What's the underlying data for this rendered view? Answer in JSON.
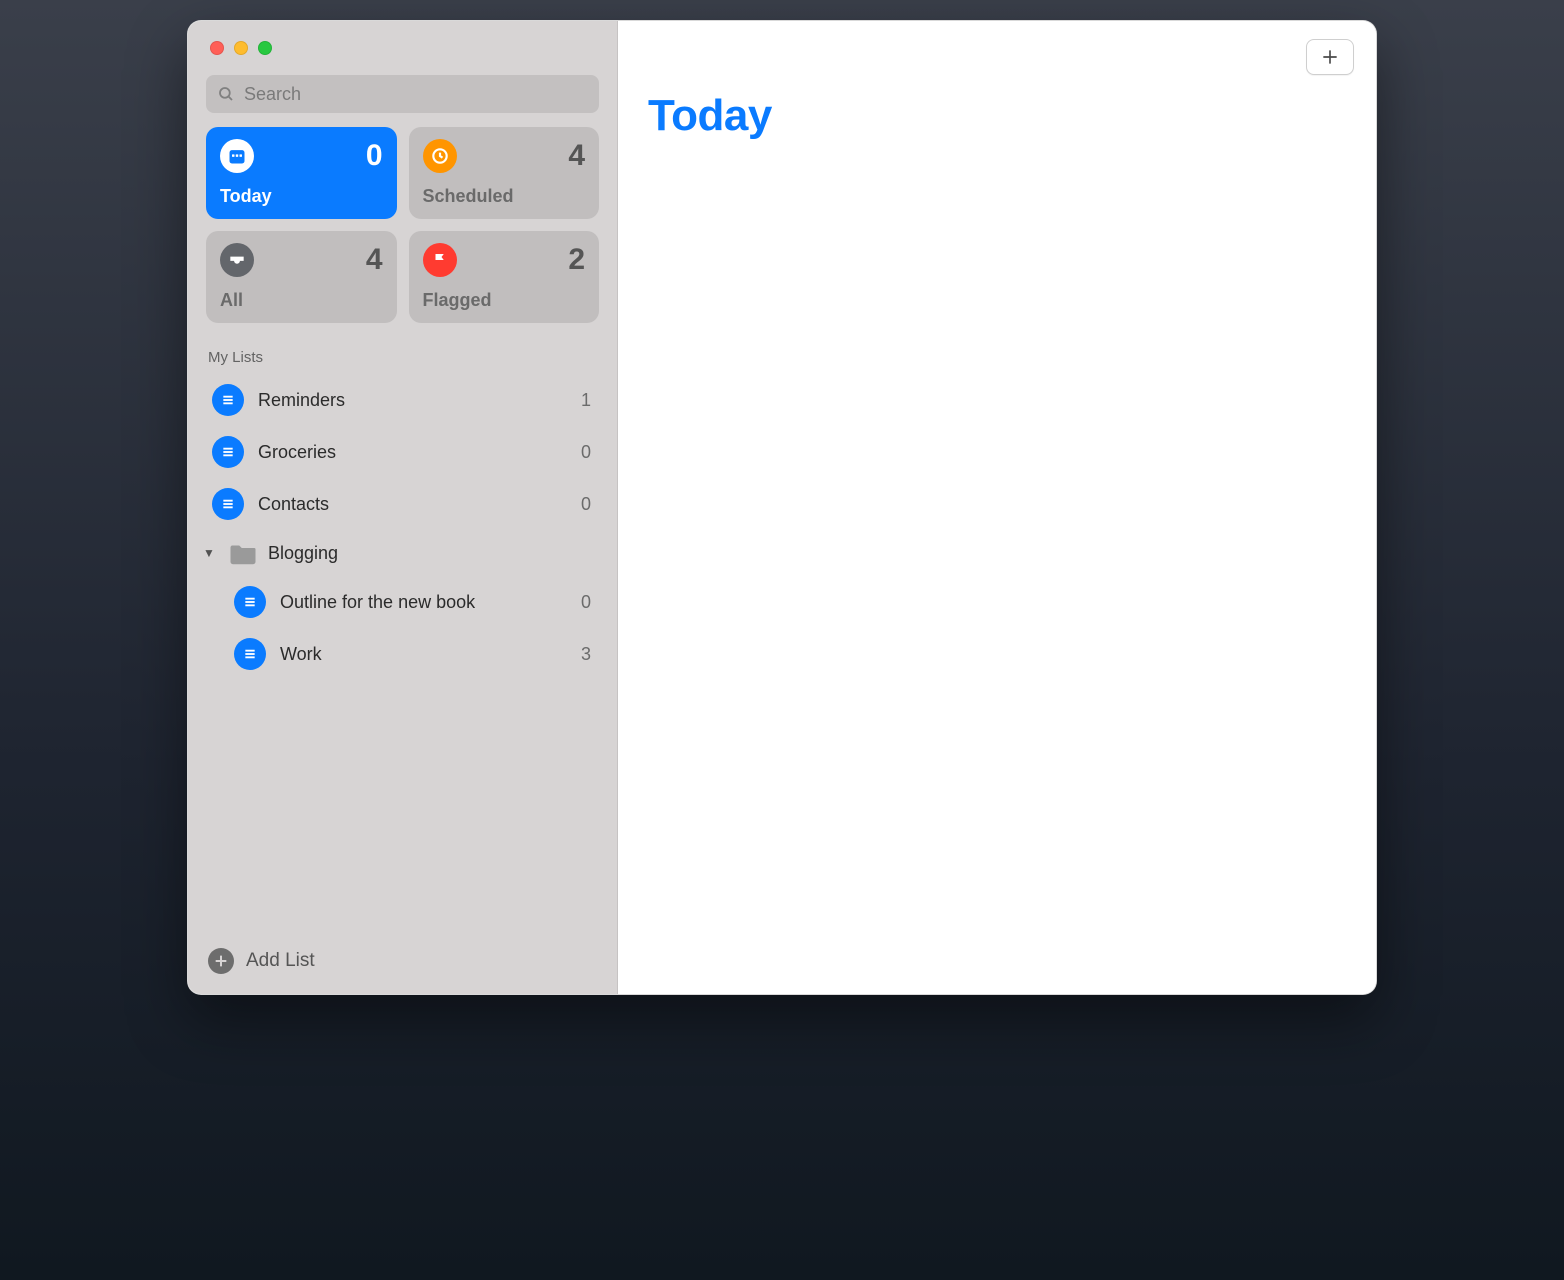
{
  "search": {
    "placeholder": "Search"
  },
  "smart": {
    "today": {
      "label": "Today",
      "count": "0"
    },
    "scheduled": {
      "label": "Scheduled",
      "count": "4"
    },
    "all": {
      "label": "All",
      "count": "4"
    },
    "flagged": {
      "label": "Flagged",
      "count": "2"
    }
  },
  "sections": {
    "my_lists": "My Lists"
  },
  "lists": {
    "reminders": {
      "label": "Reminders",
      "count": "1"
    },
    "groceries": {
      "label": "Groceries",
      "count": "0"
    },
    "contacts": {
      "label": "Contacts",
      "count": "0"
    },
    "blogging": {
      "label": "Blogging"
    },
    "outline": {
      "label": "Outline for the new book",
      "count": "0"
    },
    "work": {
      "label": "Work",
      "count": "3"
    }
  },
  "footer": {
    "add_list": "Add List"
  },
  "main": {
    "title": "Today"
  }
}
